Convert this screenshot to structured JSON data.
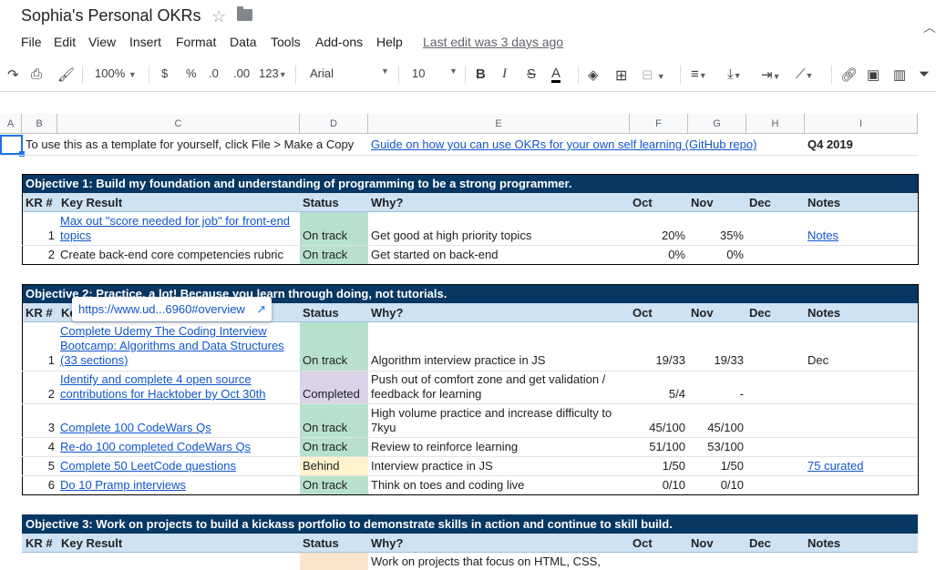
{
  "app": {
    "title": "Sophia's Personal OKRs",
    "menu": [
      "File",
      "Edit",
      "View",
      "Insert",
      "Format",
      "Data",
      "Tools",
      "Add-ons",
      "Help"
    ],
    "last_edit": "Last edit was 3 days ago"
  },
  "toolbar": {
    "zoom": "100%",
    "currency": "$",
    "percent": "%",
    "dec_less": ".0",
    "dec_more": ".00",
    "format_more": "123",
    "font": "Arial",
    "font_size": "10",
    "bold": "B",
    "italic": "I",
    "strike": "S",
    "text_color": "A"
  },
  "columns": [
    "A",
    "B",
    "C",
    "D",
    "E",
    "F",
    "G",
    "H",
    "I"
  ],
  "row_template": {
    "text": "To use this as a template for yourself, click File > Make a Copy",
    "guide": "Guide on how you can use OKRs for your own self learning (GitHub repo)",
    "quarter": "Q4 2019"
  },
  "headers": {
    "kr": "KR #",
    "key_result": "Key Result",
    "status": "Status",
    "why": "Why?",
    "oct": "Oct",
    "nov": "Nov",
    "dec": "Dec",
    "notes": "Notes"
  },
  "objective1": {
    "title": "Objective 1: Build my foundation and understanding of programming to be a strong programmer.",
    "rows": [
      {
        "kr": "1",
        "kr_line1": "Max out \"score needed for job\" for front-end",
        "kr_line2": "topics",
        "status": "On track",
        "why": "Get good at high priority topics",
        "oct": "20%",
        "nov": "35%",
        "notes": "Notes"
      },
      {
        "kr": "2",
        "kr_line1": "Create back-end core competencies rubric",
        "status": "On track",
        "why": "Get started on back-end",
        "oct": "0%",
        "nov": "0%"
      }
    ]
  },
  "objective2": {
    "title": "Objective 2: Practice, a lot! Because you learn through doing, not tutorials.",
    "tooltip": "https://www.ud...6960#overview",
    "rows": [
      {
        "kr": "1",
        "l1": "Complete Udemy The Coding Interview",
        "l2": "Bootcamp: Algorithms and Data Structures",
        "l3": "(33 sections)",
        "status": "On track",
        "why": "Algorithm interview practice in JS",
        "oct": "19/33",
        "nov": "19/33",
        "notes": "Dec"
      },
      {
        "kr": "2",
        "l1": "Identify and complete 4 open source",
        "l2": "contributions for Hacktober by Oct 30th",
        "status": "Completed",
        "why1": "Push out of comfort zone and get validation /",
        "why2": "feedback for learning",
        "oct": "5/4",
        "nov": "-"
      },
      {
        "kr": "3",
        "l1": "Complete 100 CodeWars Qs",
        "status": "On track",
        "why1": "High volume practice and increase difficulty to",
        "why2": "7kyu",
        "oct": "45/100",
        "nov": "45/100"
      },
      {
        "kr": "4",
        "l1": "Re-do 100 completed CodeWars Qs",
        "status": "On track",
        "why": "Review to reinforce learning",
        "oct": "51/100",
        "nov": "53/100"
      },
      {
        "kr": "5",
        "l1": "Complete 50 LeetCode questions",
        "status": "Behind",
        "why": "Interview practice in JS",
        "oct": "1/50",
        "nov": "1/50",
        "notes": "75 curated"
      },
      {
        "kr": "6",
        "l1": "Do 10 Pramp interviews",
        "status": "On track",
        "why": "Think on toes and coding live",
        "oct": "0/10",
        "nov": "0/10"
      }
    ]
  },
  "objective3": {
    "title": "Objective 3: Work on projects to build a kickass portfolio to demonstrate skills in action and continue to skill build.",
    "why_partial": "Work on projects that focus on HTML, CSS,"
  }
}
